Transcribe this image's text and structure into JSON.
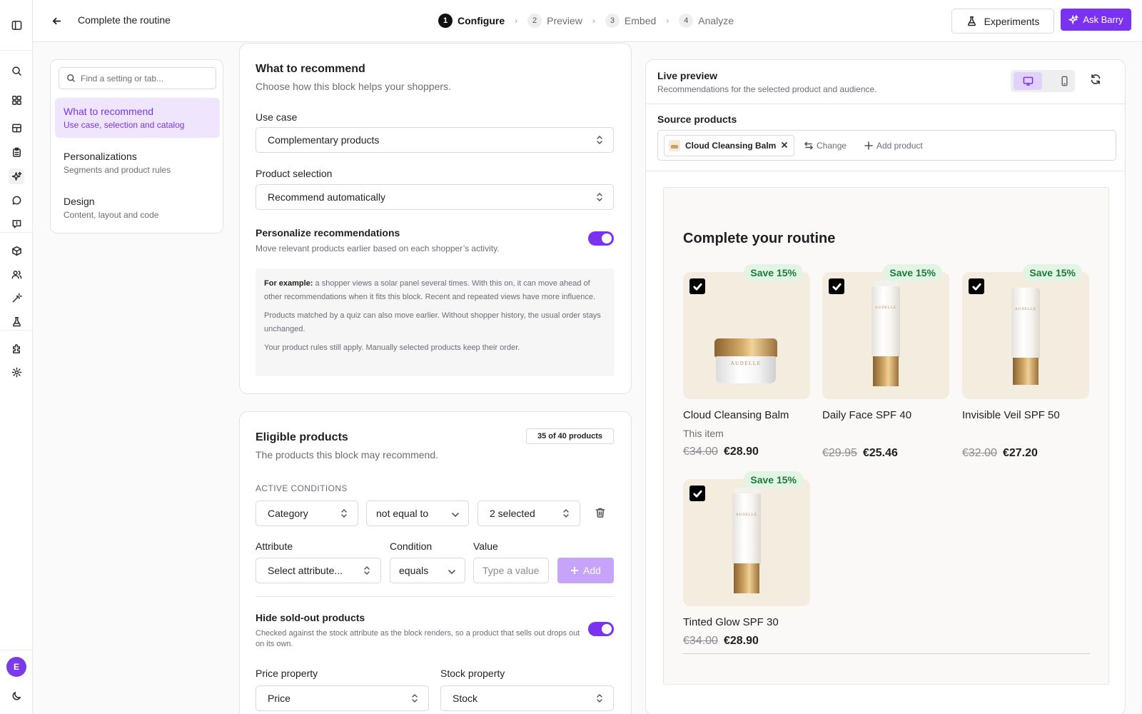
{
  "header": {
    "title": "Complete the routine",
    "steps": [
      {
        "num": "1",
        "label": "Configure"
      },
      {
        "num": "2",
        "label": "Preview"
      },
      {
        "num": "3",
        "label": "Embed"
      },
      {
        "num": "4",
        "label": "Analyze"
      }
    ],
    "experiments_label": "Experiments",
    "ask_label": "Ask Barry"
  },
  "rail": {
    "avatar_initial": "E"
  },
  "settings_nav": {
    "search_placeholder": "Find a setting or tab...",
    "items": [
      {
        "title": "What to recommend",
        "subtitle": "Use case, selection and catalog"
      },
      {
        "title": "Personalizations",
        "subtitle": "Segments and product rules"
      },
      {
        "title": "Design",
        "subtitle": "Content, layout and code"
      }
    ]
  },
  "recommend": {
    "title": "What to recommend",
    "subtitle": "Choose how this block helps your shoppers.",
    "use_case_label": "Use case",
    "use_case_value": "Complementary products",
    "selection_label": "Product selection",
    "selection_value": "Recommend automatically",
    "personalize_title": "Personalize recommendations",
    "personalize_desc": "Move relevant products earlier based on each shopper’s activity.",
    "personalize_on": true,
    "info_lead": "For example:",
    "info_p1": " a shopper views a solar panel several times. With this on, it can move ahead of other recommendations when it fits this block. Recent and repeated views have more influence.",
    "info_p2": "Products matched by a quiz can also move earlier. Without shopper history, the usual order stays unchanged.",
    "info_p3": "Your product rules still apply. Manually selected products keep their order."
  },
  "eligible": {
    "title": "Eligible products",
    "subtitle": "The products this block may recommend.",
    "count_badge": "35 of 40 products",
    "conditions_header": "ACTIVE CONDITIONS",
    "condition": {
      "field": "Category",
      "operator": "not equal to",
      "value": "2 selected"
    },
    "attribute_label": "Attribute",
    "condition_label": "Condition",
    "value_label": "Value",
    "attribute_placeholder": "Select attribute...",
    "condition_value": "equals",
    "value_placeholder": "Type a value",
    "add_label": "Add",
    "hide_soldout_title": "Hide sold-out products",
    "hide_soldout_desc": "Checked against the stock attribute as the block renders, so a product that sells out drops out on its own.",
    "hide_soldout_on": true,
    "price_property_label": "Price property",
    "price_property_value": "Price",
    "stock_property_label": "Stock property",
    "stock_property_value": "Stock"
  },
  "preview": {
    "title": "Live preview",
    "subtitle": "Recommendations for the selected product and audience.",
    "source_label": "Source products",
    "source_chip": "Cloud Cleansing Balm",
    "change_label": "Change",
    "add_product_label": "Add product",
    "widget_title": "Complete your routine",
    "products": [
      {
        "name": "Cloud Cleansing Balm",
        "note": "This item",
        "old_price": "€34.00",
        "price": "€28.90",
        "badge": "Save 15%",
        "brand": "AUDELLE"
      },
      {
        "name": "Daily Face SPF 40",
        "old_price": "€29.95",
        "price": "€25.46",
        "badge": "Save 15%",
        "brand": "AUDELLE"
      },
      {
        "name": "Invisible Veil SPF 50",
        "old_price": "€32.00",
        "price": "€27.20",
        "badge": "Save 15%",
        "brand": "AUDELLE"
      },
      {
        "name": "Tinted Glow SPF 30",
        "old_price": "€34.00",
        "price": "€28.90",
        "badge": "Save 15%",
        "brand": "AUDELLE"
      }
    ]
  },
  "colors": {
    "accent": "#7a32f0",
    "save_badge_bg": "#e2f4e4",
    "save_badge_text": "#1f7a3a"
  }
}
